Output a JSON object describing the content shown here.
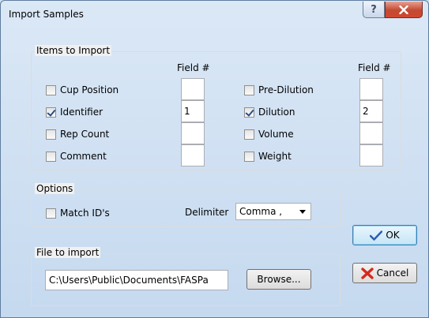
{
  "window": {
    "title": "Import Samples",
    "help_glyph": "?",
    "close_glyph": "x"
  },
  "items_group": {
    "title": "Items to Import",
    "field_header": "Field #",
    "left": [
      {
        "label": "Cup Position",
        "checked": false,
        "field": ""
      },
      {
        "label": "Identifier",
        "checked": true,
        "field": "1"
      },
      {
        "label": "Rep Count",
        "checked": false,
        "field": ""
      },
      {
        "label": "Comment",
        "checked": false,
        "field": ""
      }
    ],
    "right": [
      {
        "label": "Pre-Dilution",
        "checked": false,
        "field": ""
      },
      {
        "label": "Dilution",
        "checked": true,
        "field": "2"
      },
      {
        "label": "Volume",
        "checked": false,
        "field": ""
      },
      {
        "label": "Weight",
        "checked": false,
        "field": ""
      }
    ]
  },
  "options_group": {
    "title": "Options",
    "match_ids": {
      "label": "Match ID's",
      "checked": false
    },
    "delimiter_label": "Delimiter",
    "delimiter_value": "Comma ,"
  },
  "file_group": {
    "title": "File to import",
    "path": "C:\\Users\\Public\\Documents\\FASPa",
    "browse_label": "Browse..."
  },
  "buttons": {
    "ok_label": "OK",
    "cancel_label": "Cancel"
  },
  "icons": {
    "ok": "check-icon",
    "cancel": "x-icon"
  },
  "colors": {
    "ok_check": "#2a5db0",
    "cancel_x": "#d42a1c"
  }
}
